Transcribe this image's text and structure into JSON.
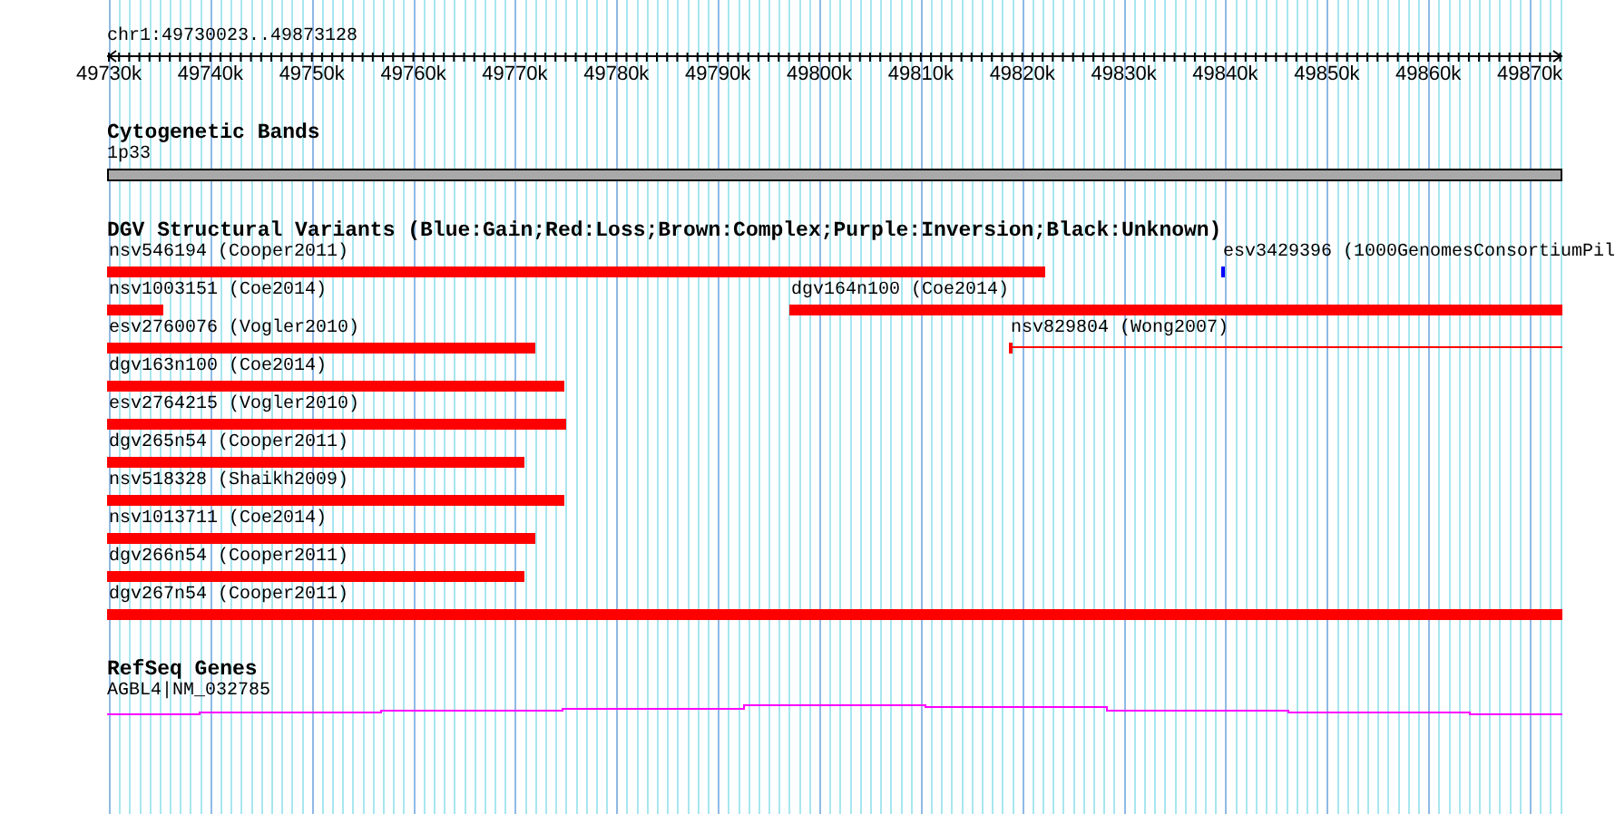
{
  "locus": "chr1:49730023..49873128",
  "ruler": {
    "ticks": [
      "49730k",
      "49740k",
      "49750k",
      "49760k",
      "49770k",
      "49780k",
      "49790k",
      "49800k",
      "49810k",
      "49820k",
      "49830k",
      "49840k",
      "49850k",
      "49860k",
      "49870k"
    ]
  },
  "tracks": [
    {
      "kind": "bands",
      "title": "Cytogenetic Bands",
      "features": [
        {
          "label": "1p33"
        }
      ]
    },
    {
      "kind": "variants",
      "title": "DGV Structural Variants (Blue:Gain;Red:Loss;Brown:Complex;Purple:Inversion;Black:Unknown)",
      "features": [
        {
          "label": "nsv546194 (Cooper2011)",
          "kind": "bar",
          "color": "#ff0000"
        },
        {
          "label": "esv3429396 (1000GenomesConsortiumPil",
          "kind": "bar",
          "color": "#0000ff"
        },
        {
          "label": "nsv1003151 (Coe2014)",
          "kind": "bar",
          "color": "#ff0000"
        },
        {
          "label": "dgv164n100 (Coe2014)",
          "kind": "bar",
          "color": "#ff0000"
        },
        {
          "label": "esv2760076 (Vogler2010)",
          "kind": "bar",
          "color": "#ff0000"
        },
        {
          "label": "nsv829804 (Wong2007)",
          "kind": "line",
          "color": "#ff0000"
        },
        {
          "label": "dgv163n100 (Coe2014)",
          "kind": "bar",
          "color": "#ff0000"
        },
        {
          "label": "esv2764215 (Vogler2010)",
          "kind": "bar",
          "color": "#ff0000"
        },
        {
          "label": "dgv265n54 (Cooper2011)",
          "kind": "bar",
          "color": "#ff0000"
        },
        {
          "label": "nsv518328 (Shaikh2009)",
          "kind": "bar",
          "color": "#ff0000"
        },
        {
          "label": "nsv1013711 (Coe2014)",
          "kind": "bar",
          "color": "#ff0000"
        },
        {
          "label": "dgv266n54 (Cooper2011)",
          "kind": "bar",
          "color": "#ff0000"
        },
        {
          "label": "dgv267n54 (Cooper2011)",
          "kind": "bar",
          "color": "#ff0000"
        }
      ]
    },
    {
      "kind": "genes",
      "title": "RefSeq Genes",
      "features": [
        {
          "label": "AGBL4|NM_032785"
        }
      ]
    }
  ]
}
